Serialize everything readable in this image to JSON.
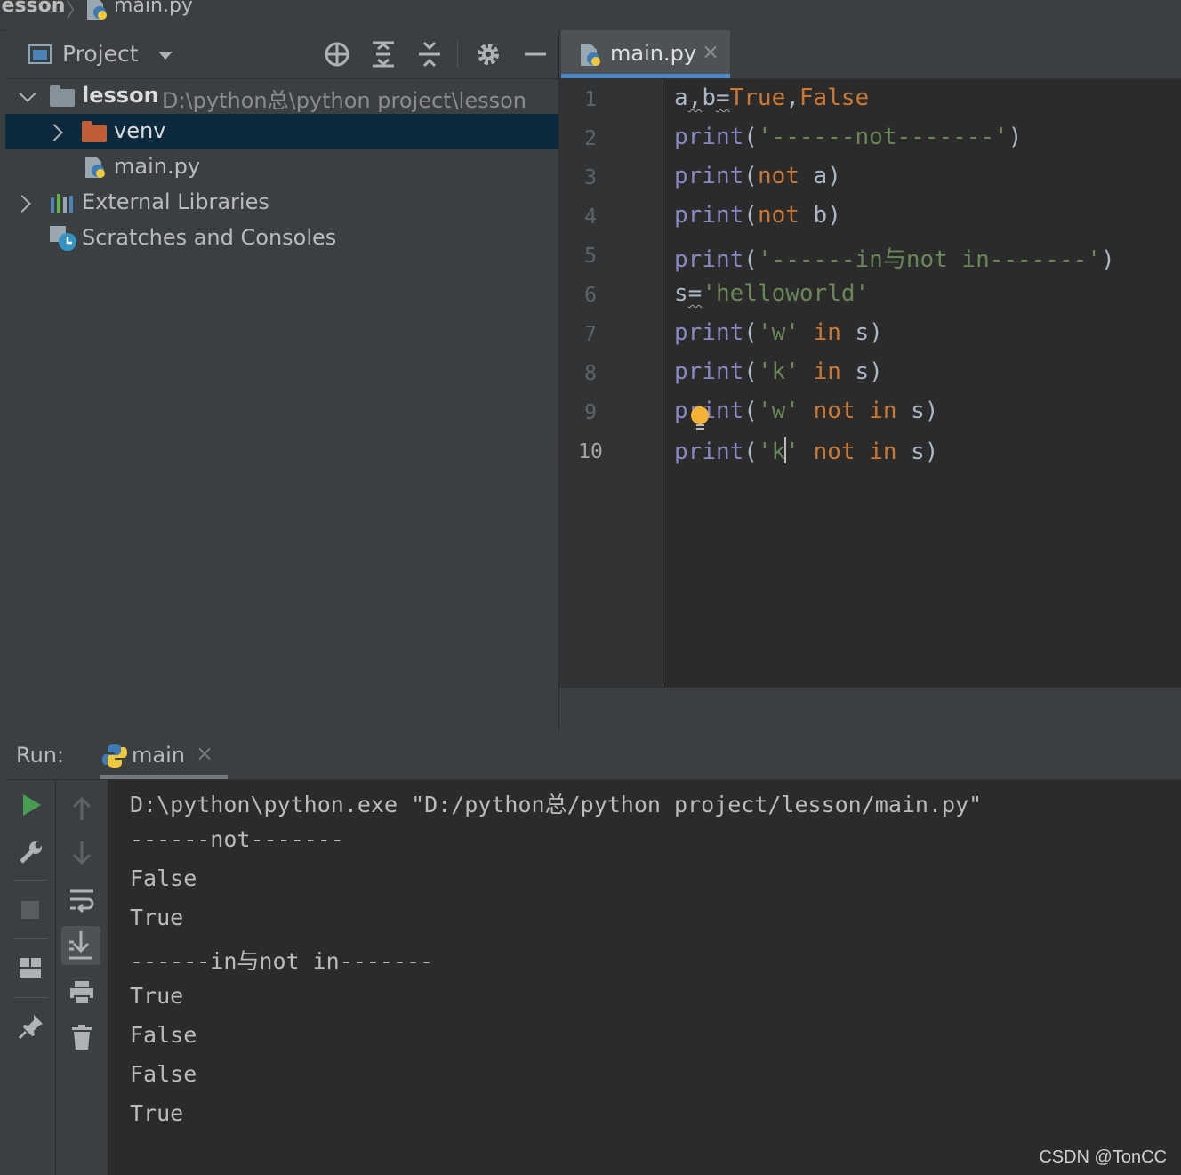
{
  "breadcrumb": {
    "project": "lesson",
    "file": "main.py"
  },
  "project_panel": {
    "title": "Project",
    "tree": [
      {
        "label": "lesson",
        "path": "D:\\python总\\python project\\lesson"
      },
      {
        "label": "venv"
      },
      {
        "label": "main.py"
      },
      {
        "label": "External Libraries"
      },
      {
        "label": "Scratches and Consoles"
      }
    ]
  },
  "editor": {
    "tab": {
      "label": "main.py",
      "close": "×"
    },
    "line_numbers": [
      "1",
      "2",
      "3",
      "4",
      "5",
      "6",
      "7",
      "8",
      "9",
      "10"
    ],
    "code": [
      "a,b=True,False",
      "print('------not-------')",
      "print(not a)",
      "print(not b)",
      "print('------in与not in-------')",
      "s='helloworld'",
      "print('w' in s)",
      "print('k' in s)",
      "print('w' not in s)",
      "print('k' not in s)"
    ],
    "current_line": 10
  },
  "run_panel": {
    "label": "Run:",
    "tab": {
      "label": "main",
      "close": "×"
    },
    "output": [
      "D:\\python\\python.exe \"D:/python总/python project/lesson/main.py\"",
      "------not-------",
      "False",
      "True",
      "------in与not in-------",
      "True",
      "False",
      "False",
      "True"
    ]
  },
  "watermark": "CSDN @TonCC",
  "colors": {
    "keyword": "#cc7832",
    "builtin": "#8888c6",
    "string": "#6a8759",
    "text": "#a9b7c6",
    "selection": "#0d293e",
    "tab_underline": "#4a88c7",
    "run_green": "#499c54",
    "bulb": "#f5b335"
  }
}
